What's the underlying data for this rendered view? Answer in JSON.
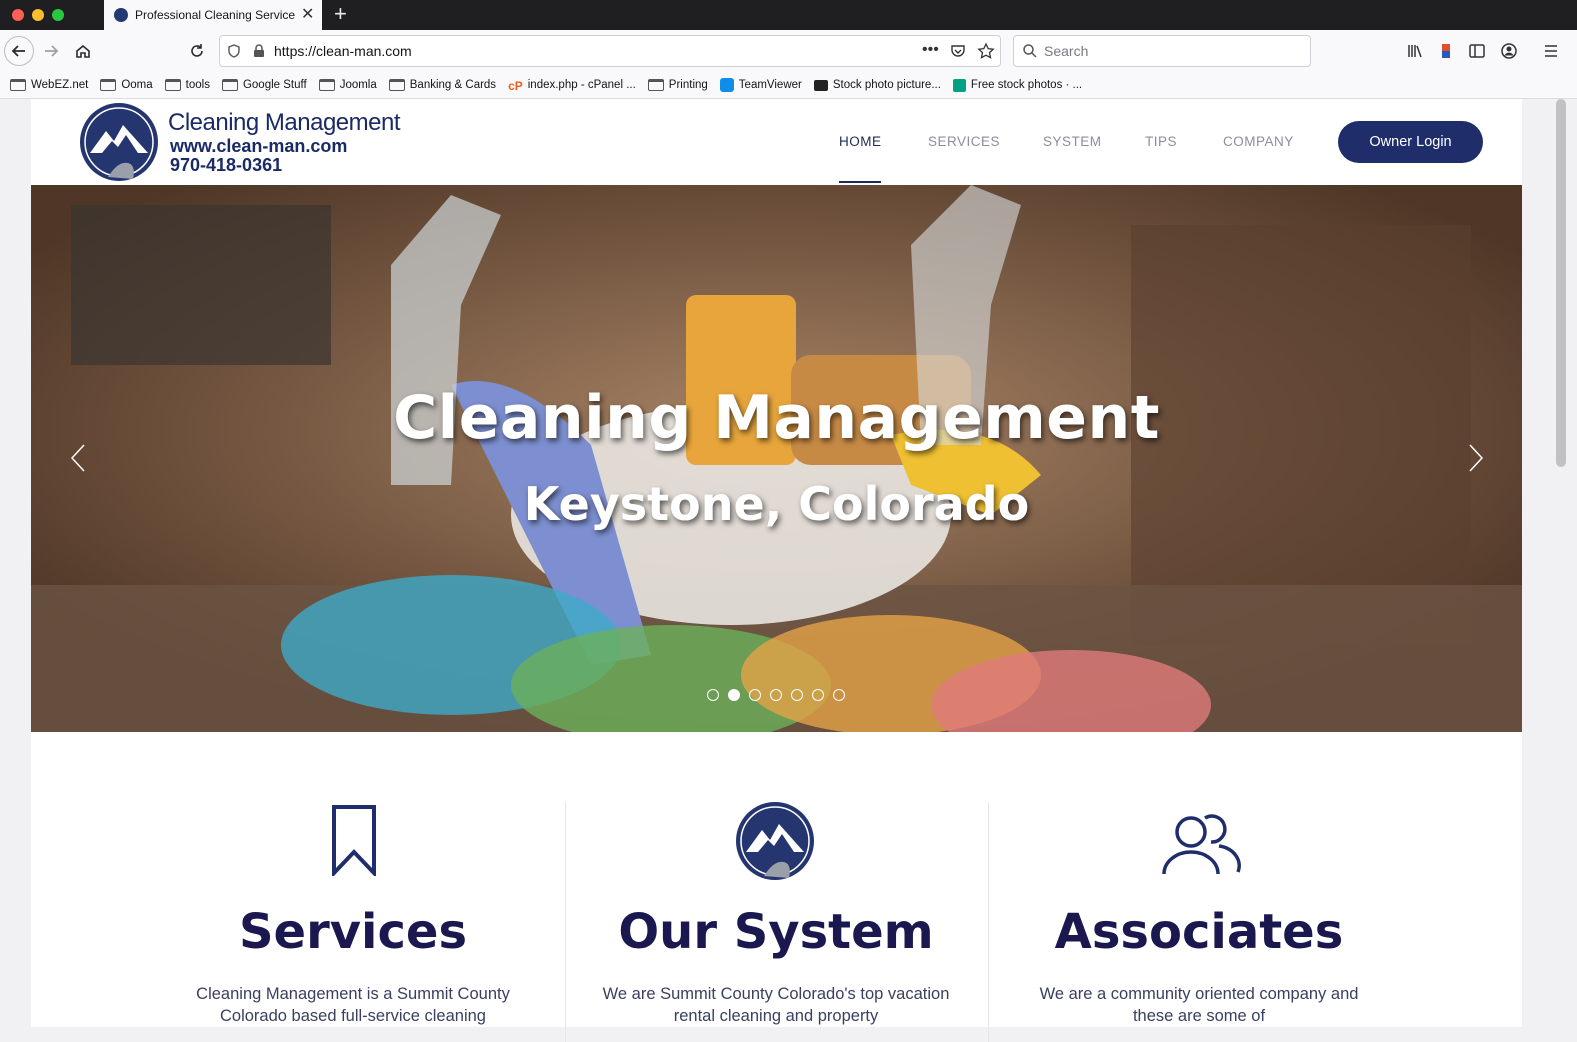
{
  "browser": {
    "tab_title": "Professional Cleaning Service - ",
    "url": "https://clean-man.com",
    "search_placeholder": "Search",
    "bookmarks": [
      {
        "label": "WebEZ.net",
        "icon": "folder-icon"
      },
      {
        "label": "Ooma",
        "icon": "folder-icon"
      },
      {
        "label": "tools",
        "icon": "folder-icon"
      },
      {
        "label": "Google Stuff",
        "icon": "folder-icon"
      },
      {
        "label": "Joomla",
        "icon": "folder-icon"
      },
      {
        "label": "Banking & Cards",
        "icon": "folder-icon"
      },
      {
        "label": "index.php - cPanel ...",
        "icon": "cpanel-icon"
      },
      {
        "label": "Printing",
        "icon": "folder-icon"
      },
      {
        "label": "TeamViewer",
        "icon": "teamviewer-icon"
      },
      {
        "label": "Stock photo picture...",
        "icon": "camera-icon"
      },
      {
        "label": "Free stock photos · ...",
        "icon": "stock-icon"
      }
    ]
  },
  "site": {
    "logo": {
      "title": "Cleaning Management",
      "url": "www.clean-man.com",
      "phone": "970-418-0361"
    },
    "menu": [
      {
        "label": "HOME",
        "active": true
      },
      {
        "label": "SERVICES",
        "active": false
      },
      {
        "label": "SYSTEM",
        "active": false
      },
      {
        "label": "TIPS",
        "active": false
      },
      {
        "label": "COMPANY",
        "active": false
      }
    ],
    "owner_login": "Owner Login",
    "hero": {
      "title": "Cleaning Management",
      "subtitle": "Keystone, Colorado",
      "slide_count": 7,
      "active_slide": 2
    },
    "features": [
      {
        "title": "Services",
        "icon": "bookmark-icon",
        "text": "Cleaning Management is a Summit County Colorado based full-service cleaning"
      },
      {
        "title": "Our System",
        "icon": "mountain-logo-icon",
        "text": "We are Summit County Colorado's top vacation rental cleaning and property"
      },
      {
        "title": "Associates",
        "icon": "users-icon",
        "text": "We are a community oriented company and these are some of"
      }
    ]
  },
  "colors": {
    "brand_navy": "#1f2d6b",
    "heading_navy": "#1b1850"
  }
}
